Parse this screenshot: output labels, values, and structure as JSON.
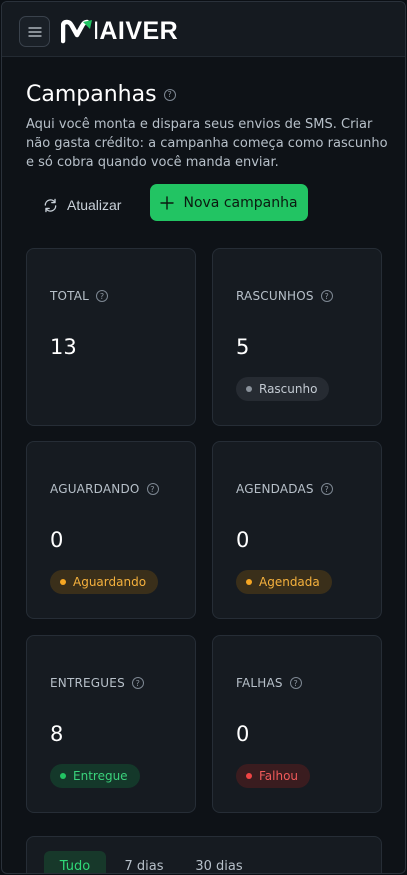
{
  "app": {
    "brand": "MAIVER"
  },
  "header": {
    "title": "Campanhas",
    "description": "Aqui você monta e dispara seus envios de SMS. Criar não gasta crédito: a campanha começa como rascunho e só cobra quando você manda enviar."
  },
  "actions": {
    "refresh_label": "Atualizar",
    "new_label": "Nova campanha"
  },
  "colors": {
    "accent": "#22c463",
    "background": "#0e1217",
    "card": "#161b21"
  },
  "stats": [
    {
      "id": "total",
      "label": "TOTAL",
      "value": "13",
      "badge": ""
    },
    {
      "id": "rascunhos",
      "label": "RASCUNHOS",
      "value": "5",
      "badge": "Rascunho",
      "tone": "gray"
    },
    {
      "id": "aguardando",
      "label": "AGUARDANDO",
      "value": "0",
      "badge": "Aguardando",
      "tone": "amber"
    },
    {
      "id": "agendadas",
      "label": "AGENDADAS",
      "value": "0",
      "badge": "Agendada",
      "tone": "amber"
    },
    {
      "id": "entregues",
      "label": "ENTREGUES",
      "value": "8",
      "badge": "Entregue",
      "tone": "green"
    },
    {
      "id": "falhas",
      "label": "FALHAS",
      "value": "0",
      "badge": "Falhou",
      "tone": "red"
    }
  ],
  "range_tabs": [
    {
      "label": "Tudo",
      "active": true
    },
    {
      "label": "7 dias",
      "active": false
    },
    {
      "label": "30 dias",
      "active": false
    }
  ]
}
